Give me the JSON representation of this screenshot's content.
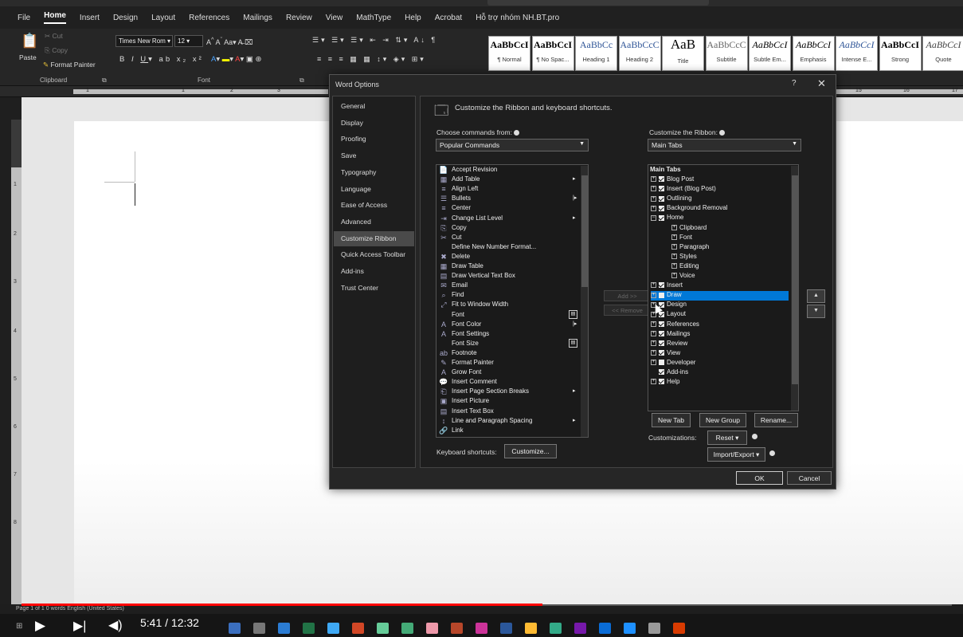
{
  "tabs": [
    "File",
    "Home",
    "Insert",
    "Design",
    "Layout",
    "References",
    "Mailings",
    "Review",
    "View",
    "MathType",
    "Help",
    "Acrobat",
    "Hỗ trợ nhóm NH.BT.pro"
  ],
  "ribbon": {
    "paste": "Paste",
    "cut": "Cut",
    "copy": "Copy",
    "format_painter": "Format Painter",
    "clipboard_label": "Clipboard",
    "font_name": "Times New Rom",
    "font_size": "12",
    "font_label": "Font",
    "styles": [
      {
        "sample": "AaBbCcI",
        "name": "¶ Normal"
      },
      {
        "sample": "AaBbCcI",
        "name": "¶ No Spac..."
      },
      {
        "sample": "AaBbCc",
        "name": "Heading 1"
      },
      {
        "sample": "AaBbCcC",
        "name": "Heading 2"
      },
      {
        "sample": "AaB",
        "name": "Title"
      },
      {
        "sample": "AaBbCcC",
        "name": "Subtitle"
      },
      {
        "sample": "AaBbCcI",
        "name": "Subtle Em..."
      },
      {
        "sample": "AaBbCcI",
        "name": "Emphasis"
      },
      {
        "sample": "AaBbCcI",
        "name": "Intense E..."
      },
      {
        "sample": "AaBbCcI",
        "name": "Strong"
      },
      {
        "sample": "AaBbCcI",
        "name": "Quote"
      }
    ]
  },
  "ruler": {
    "nums": [
      "1",
      "1",
      "2",
      "3",
      "15",
      "16",
      "17"
    ]
  },
  "vruler": {
    "nums": [
      "1",
      "2",
      "3",
      "4",
      "5",
      "6",
      "7",
      "8"
    ]
  },
  "status": {
    "text": "Page 1 of 1    0 words    English (United States)"
  },
  "video": {
    "time": "5:41 / 12:32",
    "progress": 0.56
  },
  "dialog": {
    "title": "Word Options",
    "help": "?",
    "close": "✕",
    "nav": [
      "General",
      "Display",
      "Proofing",
      "Save",
      "Typography",
      "Language",
      "Ease of Access",
      "Advanced",
      "Customize Ribbon",
      "Quick Access Toolbar",
      "Add-ins",
      "Trust Center"
    ],
    "selected_nav": "Customize Ribbon",
    "heading": "Customize the Ribbon and keyboard shortcuts.",
    "choose_label": "Choose commands from:",
    "choose_value": "Popular Commands",
    "customize_label": "Customize the Ribbon:",
    "customize_value": "Main Tabs",
    "commands": [
      {
        "icon": "📄",
        "label": "Accept Revision",
        "sub": ""
      },
      {
        "icon": "▦",
        "label": "Add Table",
        "sub": "▸"
      },
      {
        "icon": "≡",
        "label": "Align Left",
        "sub": ""
      },
      {
        "icon": "☰",
        "label": "Bullets",
        "sub": "|▸"
      },
      {
        "icon": "≡",
        "label": "Center",
        "sub": ""
      },
      {
        "icon": "⇥",
        "label": "Change List Level",
        "sub": "▸"
      },
      {
        "icon": "⎘",
        "label": "Copy",
        "sub": ""
      },
      {
        "icon": "✂",
        "label": "Cut",
        "sub": ""
      },
      {
        "icon": "",
        "label": "Define New Number Format...",
        "sub": ""
      },
      {
        "icon": "✖",
        "label": "Delete",
        "sub": ""
      },
      {
        "icon": "▦",
        "label": "Draw Table",
        "sub": ""
      },
      {
        "icon": "▤",
        "label": "Draw Vertical Text Box",
        "sub": ""
      },
      {
        "icon": "✉",
        "label": "Email",
        "sub": ""
      },
      {
        "icon": "⌕",
        "label": "Find",
        "sub": ""
      },
      {
        "icon": "⤢",
        "label": "Fit to Window Width",
        "sub": ""
      },
      {
        "icon": "",
        "label": "Font",
        "sub": "btn"
      },
      {
        "icon": "A",
        "label": "Font Color",
        "sub": "|▸"
      },
      {
        "icon": "A",
        "label": "Font Settings",
        "sub": ""
      },
      {
        "icon": "",
        "label": "Font Size",
        "sub": "btn"
      },
      {
        "icon": "ab",
        "label": "Footnote",
        "sub": ""
      },
      {
        "icon": "✎",
        "label": "Format Painter",
        "sub": ""
      },
      {
        "icon": "A",
        "label": "Grow Font",
        "sub": ""
      },
      {
        "icon": "💬",
        "label": "Insert Comment",
        "sub": ""
      },
      {
        "icon": "⎗",
        "label": "Insert Page  Section Breaks",
        "sub": "▸"
      },
      {
        "icon": "▣",
        "label": "Insert Picture",
        "sub": ""
      },
      {
        "icon": "▤",
        "label": "Insert Text Box",
        "sub": ""
      },
      {
        "icon": "↕",
        "label": "Line and Paragraph Spacing",
        "sub": "▸"
      },
      {
        "icon": "🔗",
        "label": "Link",
        "sub": ""
      }
    ],
    "add_button": "Add >>",
    "remove_button": "<< Remove",
    "main_tabs_header": "Main Tabs",
    "tab_items": [
      {
        "level": 0,
        "label": "Blog Post",
        "checked": true,
        "exp": "⊞"
      },
      {
        "level": 0,
        "label": "Insert (Blog Post)",
        "checked": true,
        "exp": "⊞"
      },
      {
        "level": 0,
        "label": "Outlining",
        "checked": true,
        "exp": "⊞"
      },
      {
        "level": 0,
        "label": "Background Removal",
        "checked": true,
        "exp": "⊞"
      },
      {
        "level": 0,
        "label": "Home",
        "checked": true,
        "exp": "⊟"
      },
      {
        "level": 1,
        "label": "Clipboard",
        "checked": null,
        "exp": "⊞"
      },
      {
        "level": 1,
        "label": "Font",
        "checked": null,
        "exp": "⊞"
      },
      {
        "level": 1,
        "label": "Paragraph",
        "checked": null,
        "exp": "⊞"
      },
      {
        "level": 1,
        "label": "Styles",
        "checked": null,
        "exp": "⊞"
      },
      {
        "level": 1,
        "label": "Editing",
        "checked": null,
        "exp": "⊞"
      },
      {
        "level": 1,
        "label": "Voice",
        "checked": null,
        "exp": "⊞"
      },
      {
        "level": 0,
        "label": "Insert",
        "checked": true,
        "exp": "⊞"
      },
      {
        "level": 0,
        "label": "Draw",
        "checked": false,
        "exp": "⊞",
        "highlight": true
      },
      {
        "level": 0,
        "label": "Design",
        "checked": true,
        "exp": "⊞"
      },
      {
        "level": 0,
        "label": "Layout",
        "checked": true,
        "exp": "⊞"
      },
      {
        "level": 0,
        "label": "References",
        "checked": true,
        "exp": "⊞"
      },
      {
        "level": 0,
        "label": "Mailings",
        "checked": true,
        "exp": "⊞"
      },
      {
        "level": 0,
        "label": "Review",
        "checked": true,
        "exp": "⊞"
      },
      {
        "level": 0,
        "label": "View",
        "checked": true,
        "exp": "⊞"
      },
      {
        "level": 0,
        "label": "Developer",
        "checked": false,
        "exp": "⊞"
      },
      {
        "level": 0,
        "label": "Add-ins",
        "checked": true,
        "exp": ""
      },
      {
        "level": 0,
        "label": "Help",
        "checked": true,
        "exp": "⊞"
      }
    ],
    "new_tab": "New Tab",
    "new_group": "New Group",
    "rename": "Rename...",
    "customizations_label": "Customizations:",
    "reset": "Reset ▾",
    "import_export": "Import/Export ▾",
    "keyboard_label": "Keyboard shortcuts:",
    "customize_button": "Customize...",
    "ok": "OK",
    "cancel": "Cancel"
  }
}
